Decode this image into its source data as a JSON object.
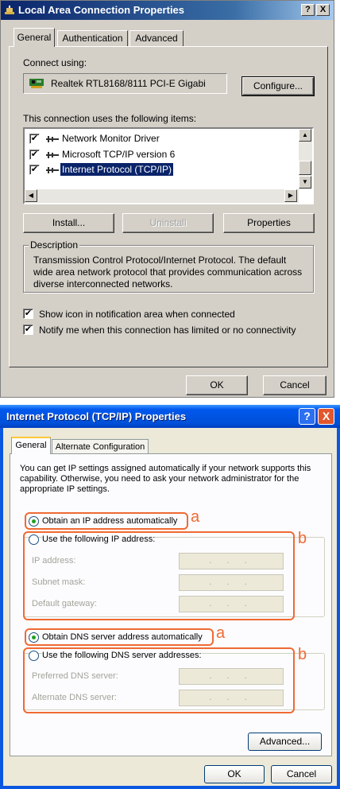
{
  "dialog1": {
    "title": "Local Area Connection Properties",
    "title_buttons": {
      "help": "?",
      "close": "X"
    },
    "tabs": [
      {
        "label": "General",
        "active": true
      },
      {
        "label": "Authentication",
        "active": false
      },
      {
        "label": "Advanced",
        "active": false
      }
    ],
    "connect_using_label": "Connect using:",
    "adapter_name": "Realtek RTL8168/8111 PCI-E Gigabi",
    "configure_button": "Configure...",
    "items_label": "This connection uses the following items:",
    "items": [
      {
        "label": "Network Monitor Driver",
        "checked": true,
        "selected": false
      },
      {
        "label": "Microsoft TCP/IP version 6",
        "checked": true,
        "selected": false
      },
      {
        "label": "Internet Protocol (TCP/IP)",
        "checked": true,
        "selected": true
      }
    ],
    "install_button": "Install...",
    "uninstall_button": "Uninstall",
    "properties_button": "Properties",
    "description_title": "Description",
    "description_text": "Transmission Control Protocol/Internet Protocol. The default wide area network protocol that provides communication across diverse interconnected networks.",
    "show_icon_label": "Show icon in notification area when connected",
    "show_icon_checked": true,
    "notify_label": "Notify me when this connection has limited or no connectivity",
    "notify_checked": true,
    "ok_button": "OK",
    "cancel_button": "Cancel"
  },
  "dialog2": {
    "title": "Internet Protocol (TCP/IP) Properties",
    "title_buttons": {
      "help": "?",
      "close": "X"
    },
    "tabs": [
      {
        "label": "General",
        "active": true
      },
      {
        "label": "Alternate Configuration",
        "active": false
      }
    ],
    "intro_text": "You can get IP settings assigned automatically if your network supports this capability. Otherwise, you need to ask your network administrator for the appropriate IP settings.",
    "obtain_ip_auto": "Obtain an IP address automatically",
    "use_following_ip": "Use the following IP address:",
    "ip_fields": [
      {
        "label": "IP address:",
        "value": ". . ."
      },
      {
        "label": "Subnet mask:",
        "value": ". . ."
      },
      {
        "label": "Default gateway:",
        "value": ". . ."
      }
    ],
    "obtain_dns_auto": "Obtain DNS server address automatically",
    "use_following_dns": "Use the following DNS server addresses:",
    "dns_fields": [
      {
        "label": "Preferred DNS server:",
        "value": ". . ."
      },
      {
        "label": "Alternate DNS server:",
        "value": ". . ."
      }
    ],
    "advanced_button": "Advanced...",
    "ok_button": "OK",
    "cancel_button": "Cancel",
    "ip_mode": "auto",
    "dns_mode": "auto"
  },
  "annotations": {
    "a": "a",
    "b": "b",
    "color": "#ef6a33"
  }
}
